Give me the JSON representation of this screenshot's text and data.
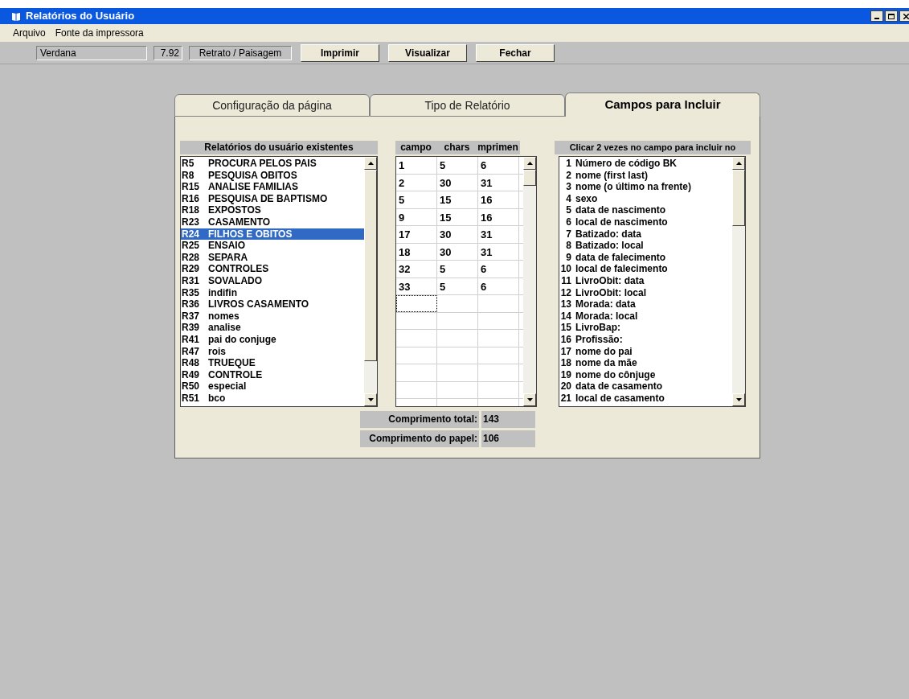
{
  "window": {
    "title": "Relatórios do Usuário"
  },
  "menu": [
    "Arquivo",
    "Fonte da impressora"
  ],
  "toolbar": {
    "font": "Verdana",
    "size": "7.92",
    "orientation": "Retrato / Paisagem",
    "buttons": [
      "Imprimir",
      "Visualizar",
      "Fechar"
    ]
  },
  "tabs": [
    {
      "label": "Configuração da página",
      "selected": false
    },
    {
      "label": "Tipo de Relatório",
      "selected": false
    },
    {
      "label": "Campos para Incluir",
      "selected": true
    }
  ],
  "reports": {
    "header": "Relatórios do usuário existentes",
    "items": [
      {
        "code": "R5",
        "name": "PROCURA PELOS PAIS",
        "selected": false
      },
      {
        "code": "R8",
        "name": "PESQUISA OBITOS",
        "selected": false
      },
      {
        "code": "R15",
        "name": "ANALISE FAMILIAS",
        "selected": false
      },
      {
        "code": "R16",
        "name": "PESQUISA DE BAPTISMO",
        "selected": false
      },
      {
        "code": "R18",
        "name": "EXPOSTOS",
        "selected": false
      },
      {
        "code": "R23",
        "name": "CASAMENTO",
        "selected": false
      },
      {
        "code": "R24",
        "name": "FILHOS E OBITOS",
        "selected": true
      },
      {
        "code": "R25",
        "name": "ENSAIO",
        "selected": false
      },
      {
        "code": "R28",
        "name": "SEPARA",
        "selected": false
      },
      {
        "code": "R29",
        "name": "CONTROLES",
        "selected": false
      },
      {
        "code": "R31",
        "name": "SOVALADO",
        "selected": false
      },
      {
        "code": "R35",
        "name": "indifin",
        "selected": false
      },
      {
        "code": "R36",
        "name": "LIVROS CASAMENTO",
        "selected": false
      },
      {
        "code": "R37",
        "name": "nomes",
        "selected": false
      },
      {
        "code": "R39",
        "name": "analise",
        "selected": false
      },
      {
        "code": "R41",
        "name": "pai do conjuge",
        "selected": false
      },
      {
        "code": "R47",
        "name": "rois",
        "selected": false
      },
      {
        "code": "R48",
        "name": "TRUEQUE",
        "selected": false
      },
      {
        "code": "R49",
        "name": "CONTROLE",
        "selected": false
      },
      {
        "code": "R50",
        "name": "especial",
        "selected": false
      },
      {
        "code": "R51",
        "name": "bco",
        "selected": false
      }
    ]
  },
  "grid": {
    "columns": [
      "campo",
      "chars",
      "mprimen"
    ],
    "rows": [
      [
        "1",
        "5",
        "6"
      ],
      [
        "2",
        "30",
        "31"
      ],
      [
        "5",
        "15",
        "16"
      ],
      [
        "9",
        "15",
        "16"
      ],
      [
        "17",
        "30",
        "31"
      ],
      [
        "18",
        "30",
        "31"
      ],
      [
        "32",
        "5",
        "6"
      ],
      [
        "33",
        "5",
        "6"
      ]
    ]
  },
  "totals": [
    {
      "label": "Comprimento total:",
      "value": "143"
    },
    {
      "label": "Comprimento do papel:",
      "value": "106"
    }
  ],
  "fields": {
    "header": "Clicar 2 vezes no campo para incluir no",
    "items": [
      {
        "number": "1",
        "name": "Número de código BK"
      },
      {
        "number": "2",
        "name": "nome (first last)"
      },
      {
        "number": "3",
        "name": "nome (o último na frente)"
      },
      {
        "number": "4",
        "name": "sexo"
      },
      {
        "number": "5",
        "name": "data de nascimento"
      },
      {
        "number": "6",
        "name": "local de nascimento"
      },
      {
        "number": "7",
        "name": "Batizado: data"
      },
      {
        "number": "8",
        "name": "Batizado: local"
      },
      {
        "number": "9",
        "name": "data de falecimento"
      },
      {
        "number": "10",
        "name": "local de falecimento"
      },
      {
        "number": "11",
        "name": "LivroObit: data"
      },
      {
        "number": "12",
        "name": "LivroObit: local"
      },
      {
        "number": "13",
        "name": "Morada: data"
      },
      {
        "number": "14",
        "name": "Morada: local"
      },
      {
        "number": "15",
        "name": "LivroBap:"
      },
      {
        "number": "16",
        "name": "Profissão:"
      },
      {
        "number": "17",
        "name": "nome do pai"
      },
      {
        "number": "18",
        "name": "nome da mãe"
      },
      {
        "number": "19",
        "name": "nome do cônjuge"
      },
      {
        "number": "20",
        "name": "data de casamento"
      },
      {
        "number": "21",
        "name": "local de casamento"
      }
    ]
  }
}
